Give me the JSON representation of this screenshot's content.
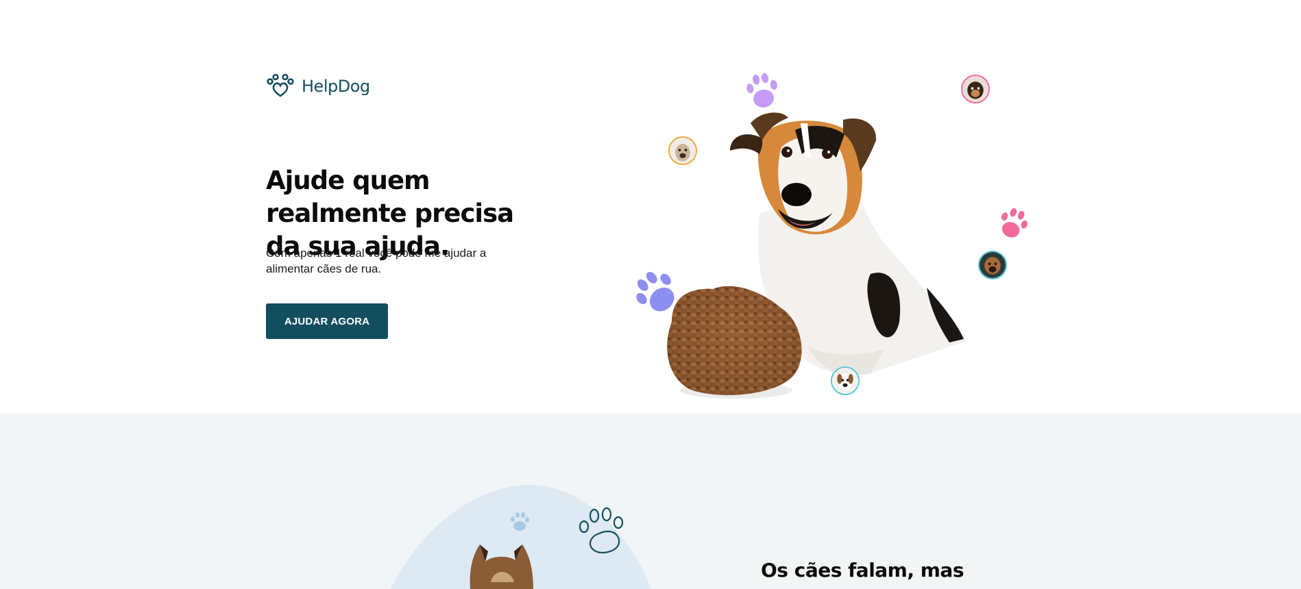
{
  "brand": {
    "name": "HelpDog",
    "color": "#134e5e"
  },
  "hero": {
    "title": "Ajude quem realmente precisa da sua ajuda.",
    "subtitle": "Com apenas 1 real você pode me ajudar a alimentar cães de rua.",
    "cta_label": "AJUDAR AGORA"
  },
  "section2": {
    "title": "Os cães falam, mas apenas"
  },
  "colors": {
    "primary": "#134e5e",
    "paw_purple": "#c59cf5",
    "paw_pink": "#f06a9a",
    "paw_blue": "#8d8ff0",
    "section_bg": "#f1f5f6",
    "blob": "#dde9f3"
  },
  "icons": [
    "paw-heart-icon",
    "paw-print-icon",
    "paw-outline-icon"
  ]
}
